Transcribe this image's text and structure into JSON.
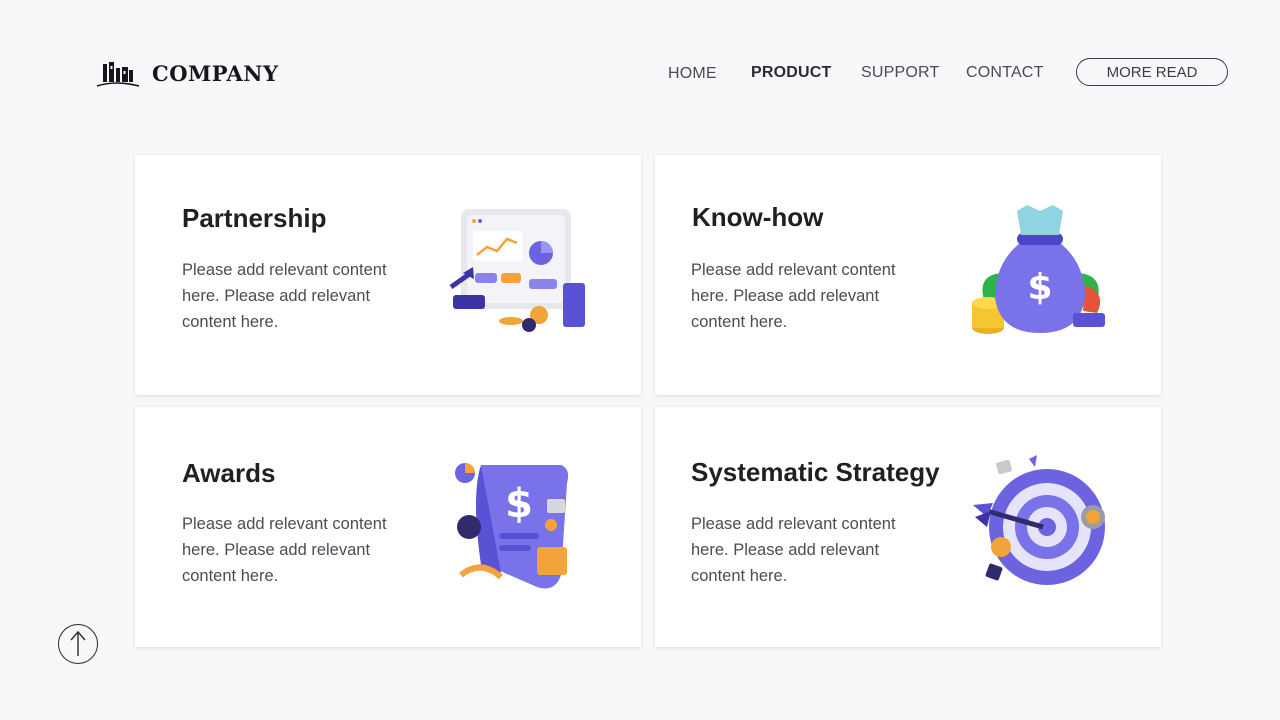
{
  "brand": {
    "name": "COMPANY"
  },
  "nav": {
    "items": [
      {
        "label": "HOME",
        "active": false
      },
      {
        "label": "PRODUCT",
        "active": true
      },
      {
        "label": "SUPPORT",
        "active": false
      },
      {
        "label": "CONTACT",
        "active": false
      }
    ],
    "cta_label": "MORE READ"
  },
  "cards": [
    {
      "title": "Partnership",
      "description": "Please add relevant content here. Please add relevant content here.",
      "icon": "analytics-dashboard-illustration"
    },
    {
      "title": "Know-how",
      "description": "Please add relevant content here. Please add relevant content here.",
      "icon": "money-bag-illustration"
    },
    {
      "title": "Awards",
      "description": "Please add relevant content here. Please add relevant content here.",
      "icon": "invoice-scroll-illustration"
    },
    {
      "title": "Systematic Strategy",
      "description": "Please add relevant content here. Please add relevant content here.",
      "icon": "target-dart-illustration"
    }
  ],
  "colors": {
    "background": "#f8f8fa",
    "card": "#ffffff",
    "accent_purple": "#6b63e0",
    "accent_orange": "#f2a33a"
  },
  "scroll_top_icon": "arrow-up-icon"
}
